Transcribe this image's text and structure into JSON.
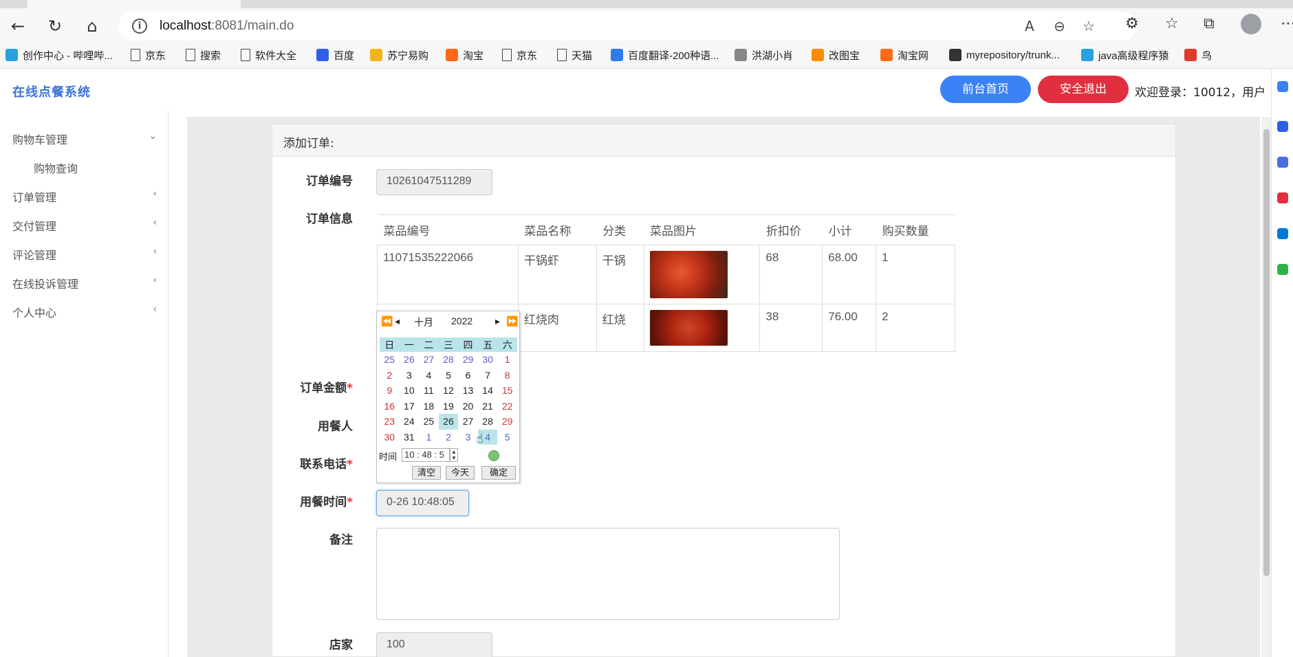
{
  "browser": {
    "url_host": "localhost",
    "url_rest": ":8081/main.do",
    "bookmarks": [
      {
        "label": "创作中心 - 哔哩哔...",
        "color": "#2aa0e0"
      },
      {
        "label": "京东",
        "color": "doc"
      },
      {
        "label": "搜索",
        "color": "doc"
      },
      {
        "label": "软件大全",
        "color": "doc"
      },
      {
        "label": "百度",
        "color": "#2f5ee8"
      },
      {
        "label": "苏宁易购",
        "color": "#f5b31b"
      },
      {
        "label": "淘宝",
        "color": "#ff6a1a"
      },
      {
        "label": "京东",
        "color": "doc"
      },
      {
        "label": "天猫",
        "color": "doc"
      },
      {
        "label": "百度翻译-200种语...",
        "color": "#2f7be8"
      },
      {
        "label": "洪湖小肖",
        "color": "#888888"
      },
      {
        "label": "改图宝",
        "color": "#ff8a00"
      },
      {
        "label": "淘宝网",
        "color": "#ff6a1a"
      },
      {
        "label": "myrepository/trunk...",
        "color": "#333333"
      },
      {
        "label": "java高级程序猿",
        "color": "#2aa0e0"
      },
      {
        "label": "鸟",
        "color": "#e03a2a"
      }
    ]
  },
  "header": {
    "brand": "在线点餐系统",
    "home_button": "前台首页",
    "logout_button": "安全退出",
    "welcome": "欢迎登录：10012，用户"
  },
  "sidebar": {
    "items": [
      {
        "label": "购物车管理",
        "arrow": "⌄"
      },
      {
        "label": "订单管理",
        "arrow": "‹"
      },
      {
        "label": "交付管理",
        "arrow": "‹"
      },
      {
        "label": "评论管理",
        "arrow": "‹"
      },
      {
        "label": "在线投诉管理",
        "arrow": "‹"
      },
      {
        "label": "个人中心",
        "arrow": "‹"
      }
    ],
    "sub_item": "购物查询"
  },
  "form": {
    "title": "添加订单:",
    "order_no_label": "订单编号",
    "order_no_value": "10261047511289",
    "order_info_label": "订单信息",
    "amount_label": "订单金额",
    "diner_label": "用餐人",
    "phone_label": "联系电话",
    "time_label": "用餐时间",
    "time_value": "0-26 10:48:05",
    "remark_label": "备注",
    "shop_label": "店家",
    "shop_value": "100",
    "required_mark": "*"
  },
  "table": {
    "headers": [
      "菜品编号",
      "菜品名称",
      "分类",
      "菜品图片",
      "折扣价",
      "小计",
      "购买数量"
    ],
    "rows": [
      {
        "id": "11071535222066",
        "name": "干锅虾",
        "category": "干锅",
        "price": "68",
        "subtotal": "68.00",
        "qty": "1"
      },
      {
        "id": "",
        "name": "红烧肉",
        "category": "红烧",
        "price": "38",
        "subtotal": "76.00",
        "qty": "2"
      }
    ]
  },
  "calendar": {
    "month": "十月",
    "year": "2022",
    "weekdays": [
      "日",
      "一",
      "二",
      "三",
      "四",
      "五",
      "六"
    ],
    "weeks": [
      [
        "25",
        "26",
        "27",
        "28",
        "29",
        "30",
        "1"
      ],
      [
        "2",
        "3",
        "4",
        "5",
        "6",
        "7",
        "8"
      ],
      [
        "9",
        "10",
        "11",
        "12",
        "13",
        "14",
        "15"
      ],
      [
        "16",
        "17",
        "18",
        "19",
        "20",
        "21",
        "22"
      ],
      [
        "23",
        "24",
        "25",
        "26",
        "27",
        "28",
        "29"
      ],
      [
        "30",
        "31",
        "1",
        "2",
        "3",
        "4",
        "5"
      ]
    ],
    "time_label": "时间",
    "time_value": "10 : 48 : 5",
    "clear_button": "清空",
    "today_button": "今天",
    "ok_button": "确定"
  },
  "colors": {
    "brand": "#3b74d9",
    "home_button": "#3b82f6",
    "logout_button": "#e0303f",
    "required": "#e33333"
  }
}
